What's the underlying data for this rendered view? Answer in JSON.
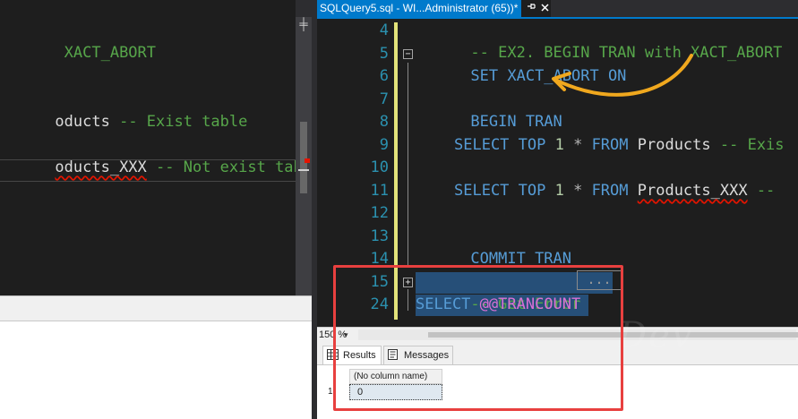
{
  "left": {
    "lines": [
      {
        "text": " XACT_ABORT",
        "color": "#57a64a"
      },
      {
        "text": "",
        "color": "#dcdcdc"
      },
      {
        "text": "",
        "color": "#dcdcdc"
      },
      {
        "text": "oducts",
        "color": "#dcdcdc",
        "comment": " -- Exist table"
      },
      {
        "text": "",
        "color": "#dcdcdc"
      },
      {
        "text": "oducts_XXX",
        "color": "#dcdcdc",
        "comment": " -- Not exist table"
      }
    ],
    "split_glyph": "╪"
  },
  "tab": {
    "title": "SQLQuery5.sql - WI...Administrator (65))*",
    "pin_icon": "pin-icon",
    "close_icon": "close-icon"
  },
  "editor": {
    "line_numbers": [
      "4",
      "5",
      "6",
      "7",
      "8",
      "9",
      "10",
      "11",
      "12",
      "13",
      "14",
      "15",
      "24"
    ],
    "l4": "-- EX2. BEGIN TRAN with XACT_ABORT",
    "l5_kw": "SET XACT_ABORT ON",
    "l7_kw": "BEGIN TRAN",
    "l9_kw1": "SELECT TOP ",
    "l9_num": "1",
    "l9_star": " * ",
    "l9_kw2": "FROM ",
    "l9_id": "Products",
    "l9_cm": " -- Exis",
    "l11_kw1": "SELECT TOP ",
    "l11_num": "1",
    "l11_star": " * ",
    "l11_kw2": "FROM ",
    "l11_id": "Products_XXX",
    "l11_cm": " --",
    "l13_kw": "COMMIT TRAN",
    "l15_cm": "-- Get Error",
    "l15_collapsed": "...",
    "l24_kw": "SELECT ",
    "l24_sys": "@@TRANCOUNT",
    "fold_minus": "−",
    "fold_plus": "+"
  },
  "zoom": {
    "value": "150 %",
    "arrow": "▾"
  },
  "results": {
    "tabs": [
      {
        "label": "Results",
        "icon": "grid-icon"
      },
      {
        "label": "Messages",
        "icon": "messages-icon"
      }
    ],
    "column_header": "(No column name)",
    "row_number": "1",
    "cell_value": "0"
  },
  "colors": {
    "keyword": "#569cd6",
    "comment": "#57a64a",
    "line_number": "#2b91af",
    "selection": "#264f78",
    "annotation_red": "#e8403f",
    "annotation_orange": "#f0a81e",
    "accent": "#007acc"
  }
}
